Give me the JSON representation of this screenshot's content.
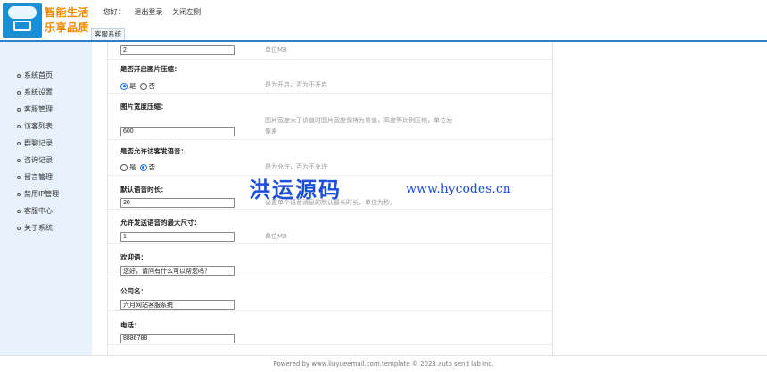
{
  "brand": {
    "line1": "智能生活",
    "line2": "乐享品质"
  },
  "header": {
    "greeting": "您好：",
    "logout": "退出登录",
    "close_left": "关闭左侧",
    "tab": "客服系统"
  },
  "sidebar": {
    "items": [
      {
        "label": "系统首页"
      },
      {
        "label": "系统设置"
      },
      {
        "label": "客服管理"
      },
      {
        "label": "访客列表"
      },
      {
        "label": "群聊记录"
      },
      {
        "label": "咨询记录"
      },
      {
        "label": "留言管理"
      },
      {
        "label": "禁用IP管理"
      },
      {
        "label": "客服中心"
      },
      {
        "label": "关于系统"
      }
    ]
  },
  "form": {
    "image_size": {
      "value": "2",
      "hint": "单位MB"
    },
    "compress": {
      "label": "是否开启图片压缩：",
      "opt_yes": "是",
      "opt_no": "否",
      "selected": "yes",
      "hint": "是为开启，否为不开启"
    },
    "width": {
      "label": "图片宽度压缩：",
      "value": "600",
      "hint": "图片宽度大于该值时图片宽度保持为该值，高度等比例压缩，单位为像素"
    },
    "voice": {
      "label": "是否允许访客发语音：",
      "opt_yes": "是",
      "opt_no": "否",
      "selected": "no",
      "hint": "是为允许，否为不允许"
    },
    "voice_len": {
      "label": "默认语音时长：",
      "value": "30",
      "hint": "设置单个语音消息的默认最长时长，单位为秒。"
    },
    "voice_size": {
      "label": "允许发送语音的最大尺寸：",
      "value": "1",
      "hint": "单位MB"
    },
    "welcome": {
      "label": "欢迎语：",
      "value": "您好，请问有什么可以帮您吗？"
    },
    "company": {
      "label": "公司名：",
      "value": "六月网站客服系统"
    },
    "phone": {
      "label": "电话：",
      "value": "8886788"
    }
  },
  "watermark": {
    "cn": "洪运源码",
    "url": "www.hycodes.cn"
  },
  "footer": {
    "text": "Powered by www.liuyueemail.com.template © 2023.auto send lab inc."
  },
  "colors": {
    "accent": "#2f7fc8",
    "sidebar_bg": "#e7f2fc",
    "brand": "#f08a00",
    "watermark": "#1d4fd8"
  }
}
